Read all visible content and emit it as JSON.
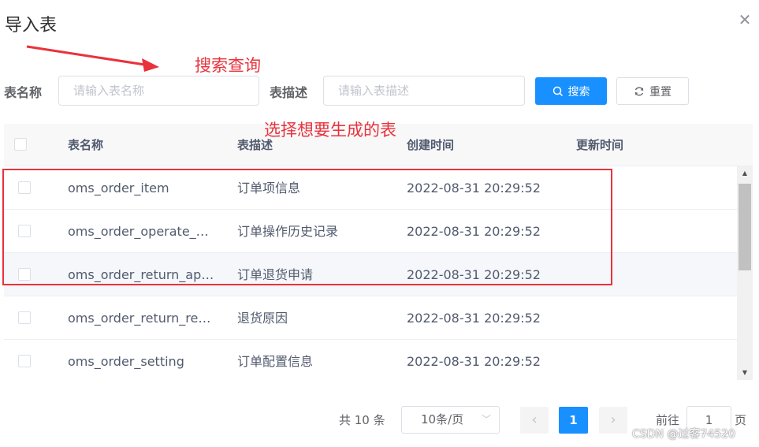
{
  "dialog": {
    "title": "导入表",
    "close_icon": "close-icon"
  },
  "annotations": {
    "search_hint": "搜索查询",
    "select_hint": "选择想要生成的表",
    "color": "#e8323c"
  },
  "form": {
    "table_name_label": "表名称",
    "table_name_placeholder": "请输入表名称",
    "table_name_value": "",
    "table_desc_label": "表描述",
    "table_desc_placeholder": "请输入表描述",
    "table_desc_value": "",
    "search_button": "搜索",
    "reset_button": "重置"
  },
  "table": {
    "headers": [
      "表名称",
      "表描述",
      "创建时间",
      "更新时间"
    ],
    "rows": [
      {
        "name": "oms_order_item",
        "desc": "订单项信息",
        "created": "2022-08-31 20:29:52",
        "updated": ""
      },
      {
        "name": "oms_order_operate_…",
        "desc": "订单操作历史记录",
        "created": "2022-08-31 20:29:52",
        "updated": ""
      },
      {
        "name": "oms_order_return_ap…",
        "desc": "订单退货申请",
        "created": "2022-08-31 20:29:52",
        "updated": ""
      },
      {
        "name": "oms_order_return_re…",
        "desc": "退货原因",
        "created": "2022-08-31 20:29:52",
        "updated": ""
      },
      {
        "name": "oms_order_setting",
        "desc": "订单配置信息",
        "created": "2022-08-31 20:29:52",
        "updated": ""
      }
    ]
  },
  "pagination": {
    "total": "共 10 条",
    "page_size": "10条/页",
    "current_page": "1",
    "goto_prefix": "前往",
    "goto_value": "1",
    "goto_suffix": "页"
  },
  "watermark": "CSDN @过客74520",
  "colors": {
    "primary": "#1890ff",
    "highlight": "#e8323c"
  }
}
